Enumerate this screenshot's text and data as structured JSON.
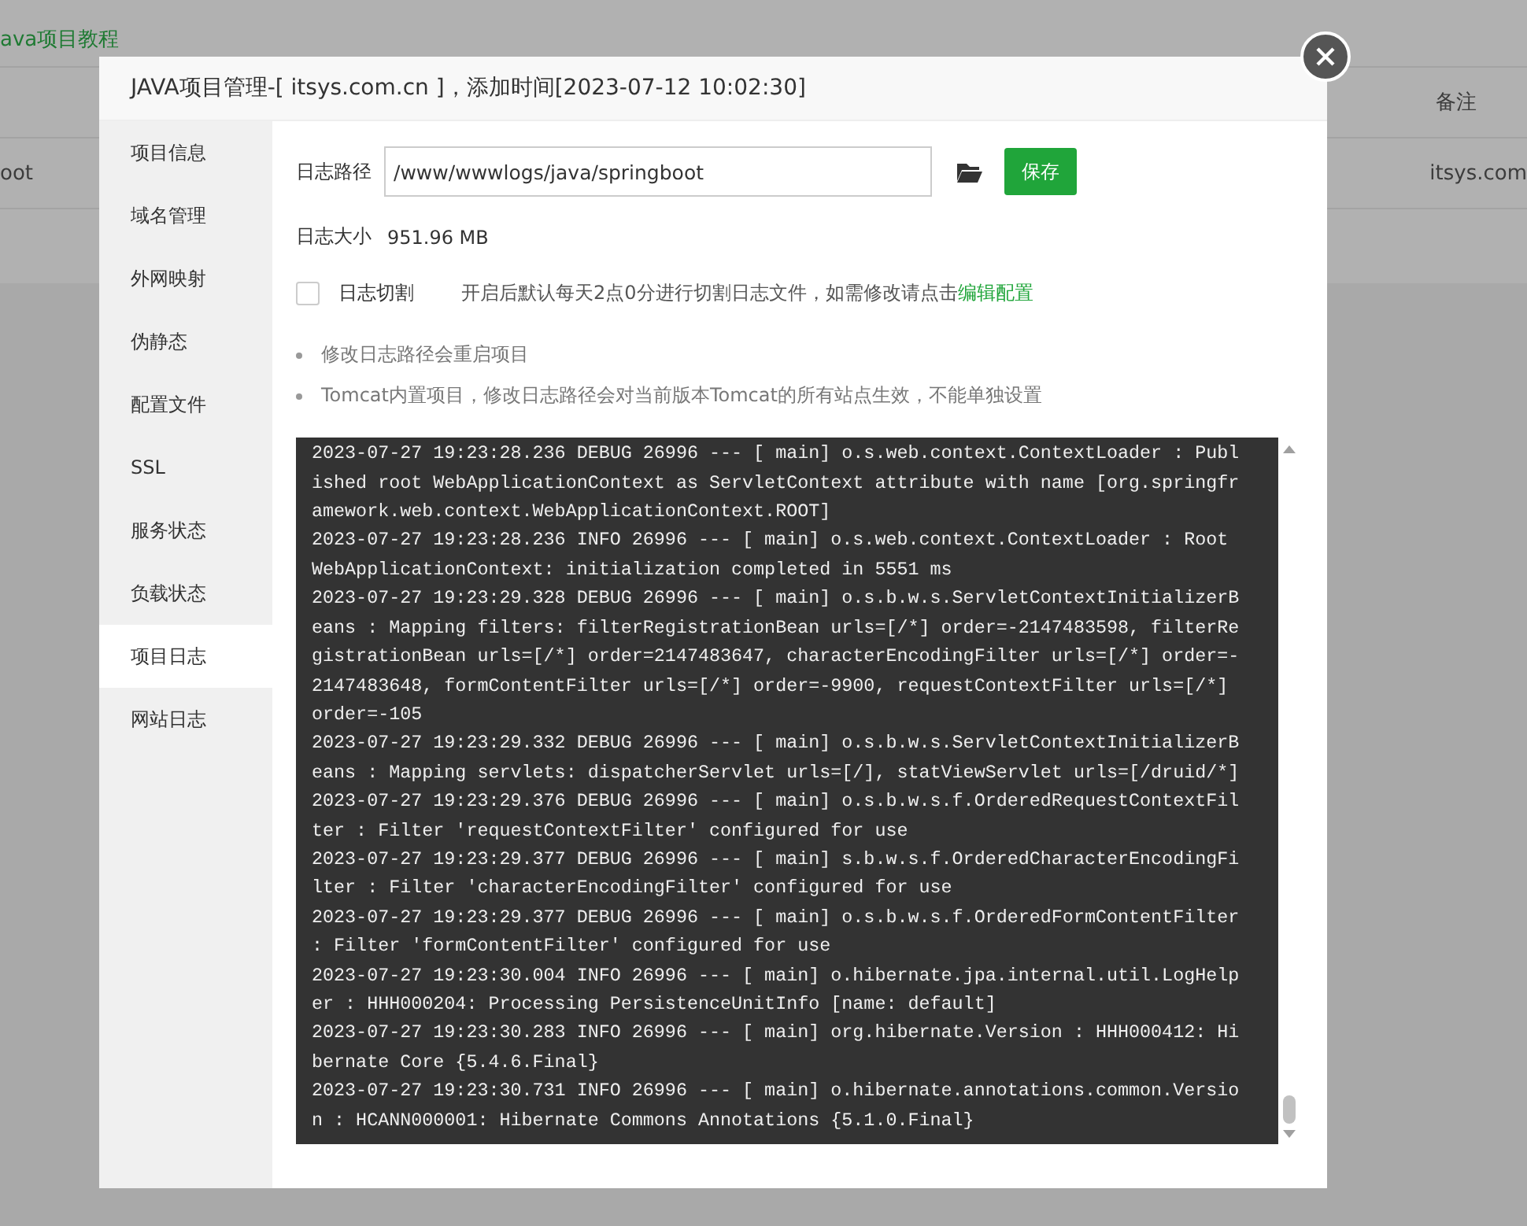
{
  "background": {
    "link": "ava项目教程",
    "table": {
      "columns": [
        "",
        "备注"
      ],
      "rows": [
        [
          "oot",
          "itsys.com"
        ]
      ]
    }
  },
  "dialog": {
    "title": "JAVA项目管理-[ itsys.com.cn ]，添加时间[2023-07-12 10:02:30]",
    "sidebar": [
      {
        "label": "项目信息",
        "selected": false
      },
      {
        "label": "域名管理",
        "selected": false
      },
      {
        "label": "外网映射",
        "selected": false
      },
      {
        "label": "伪静态",
        "selected": false
      },
      {
        "label": "配置文件",
        "selected": false
      },
      {
        "label": "SSL",
        "selected": false
      },
      {
        "label": "服务状态",
        "selected": false
      },
      {
        "label": "负载状态",
        "selected": false
      },
      {
        "label": "项目日志",
        "selected": true
      },
      {
        "label": "网站日志",
        "selected": false
      }
    ],
    "log_path": {
      "label": "日志路径",
      "value": "/www/wwwlogs/java/springboot",
      "save": "保存"
    },
    "log_size": {
      "label": "日志大小",
      "value": "951.96 MB"
    },
    "rotate": {
      "label": "日志切割",
      "checked": false,
      "hint": "开启后默认每天2点0分进行切割日志文件，如需修改请点击",
      "link": "编辑配置"
    },
    "notes": [
      "修改日志路径会重启项目",
      "Tomcat内置项目，修改日志路径会对当前版本Tomcat的所有站点生效，不能单独设置"
    ],
    "log": [
      "2023-07-27 19:23:28.236 DEBUG 26996 --- [ main] o.s.web.context.ContextLoader : Published root WebApplicationContext as ServletContext attribute with name [org.springframework.web.context.WebApplicationContext.ROOT]",
      "2023-07-27 19:23:28.236 INFO 26996 --- [ main] o.s.web.context.ContextLoader : Root WebApplicationContext: initialization completed in 5551 ms",
      "2023-07-27 19:23:29.328 DEBUG 26996 --- [ main] o.s.b.w.s.ServletContextInitializerBeans : Mapping filters: filterRegistrationBean urls=[/*] order=-2147483598, filterRegistrationBean urls=[/*] order=2147483647, characterEncodingFilter urls=[/*] order=-2147483648, formContentFilter urls=[/*] order=-9900, requestContextFilter urls=[/*] order=-105",
      "2023-07-27 19:23:29.332 DEBUG 26996 --- [ main] o.s.b.w.s.ServletContextInitializerBeans : Mapping servlets: dispatcherServlet urls=[/], statViewServlet urls=[/druid/*]",
      "2023-07-27 19:23:29.376 DEBUG 26996 --- [ main] o.s.b.w.s.f.OrderedRequestContextFilter : Filter 'requestContextFilter' configured for use",
      "2023-07-27 19:23:29.377 DEBUG 26996 --- [ main] s.b.w.s.f.OrderedCharacterEncodingFilter : Filter 'characterEncodingFilter' configured for use",
      "2023-07-27 19:23:29.377 DEBUG 26996 --- [ main] o.s.b.w.s.f.OrderedFormContentFilter : Filter 'formContentFilter' configured for use",
      "2023-07-27 19:23:30.004 INFO 26996 --- [ main] o.hibernate.jpa.internal.util.LogHelper : HHH000204: Processing PersistenceUnitInfo [name: default]",
      "2023-07-27 19:23:30.283 INFO 26996 --- [ main] org.hibernate.Version : HHH000412: Hibernate Core {5.4.6.Final}",
      "2023-07-27 19:23:30.731 INFO 26996 --- [ main] o.hibernate.annotations.common.Version : HCANN000001: Hibernate Commons Annotations {5.1.0.Final}"
    ]
  }
}
